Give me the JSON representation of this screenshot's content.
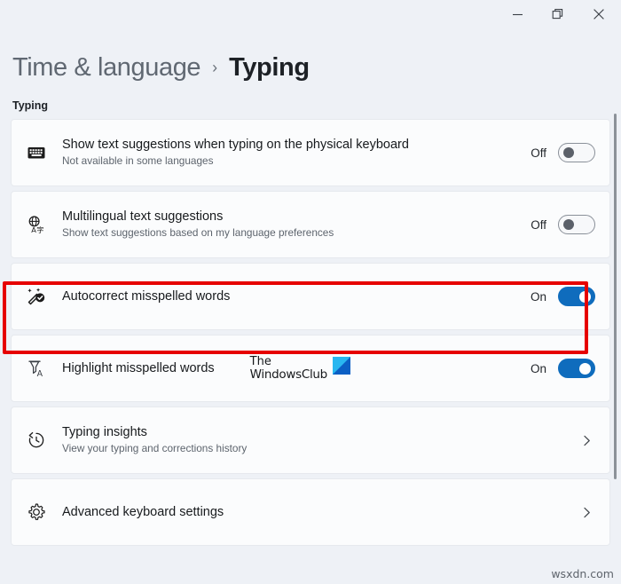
{
  "window": {
    "controls": [
      {
        "name": "minimize",
        "glyph": "minimize-icon"
      },
      {
        "name": "restore",
        "glyph": "restore-icon"
      },
      {
        "name": "close",
        "glyph": "close-icon"
      }
    ]
  },
  "header": {
    "parent": "Time & language",
    "separator": "›",
    "current": "Typing"
  },
  "section": {
    "label": "Typing"
  },
  "settings": [
    {
      "icon": "keyboard-icon",
      "title": "Show text suggestions when typing on the physical keyboard",
      "subtitle": "Not available in some languages",
      "control": "toggle",
      "state_label": "Off",
      "state": "off"
    },
    {
      "icon": "translate-globe-icon",
      "title": "Multilingual text suggestions",
      "subtitle": "Show text suggestions based on my language preferences",
      "control": "toggle",
      "state_label": "Off",
      "state": "off"
    },
    {
      "icon": "magic-wand-check-icon",
      "title": "Autocorrect misspelled words",
      "subtitle": "",
      "control": "toggle",
      "state_label": "On",
      "state": "on",
      "highlighted": true
    },
    {
      "icon": "highlighter-a-icon",
      "title": "Highlight misspelled words",
      "subtitle": "",
      "control": "toggle",
      "state_label": "On",
      "state": "on"
    },
    {
      "icon": "history-clock-icon",
      "title": "Typing insights",
      "subtitle": "View your typing and corrections history",
      "control": "chevron",
      "state_label": "",
      "state": ""
    },
    {
      "icon": "gear-icon",
      "title": "Advanced keyboard settings",
      "subtitle": "",
      "control": "chevron",
      "state_label": "",
      "state": ""
    }
  ],
  "watermark": {
    "logo_line1": "The",
    "logo_line2": "WindowsClub",
    "mark_color_light": "#29b7f0",
    "mark_color_dark": "#0b5fc4",
    "bottom_text": "wsxdn.com"
  },
  "colors": {
    "page_background": "#eef1f6",
    "card_background": "#fbfcfd",
    "accent_toggle_on": "#0f6cbd",
    "annotation_red": "#e60000"
  }
}
